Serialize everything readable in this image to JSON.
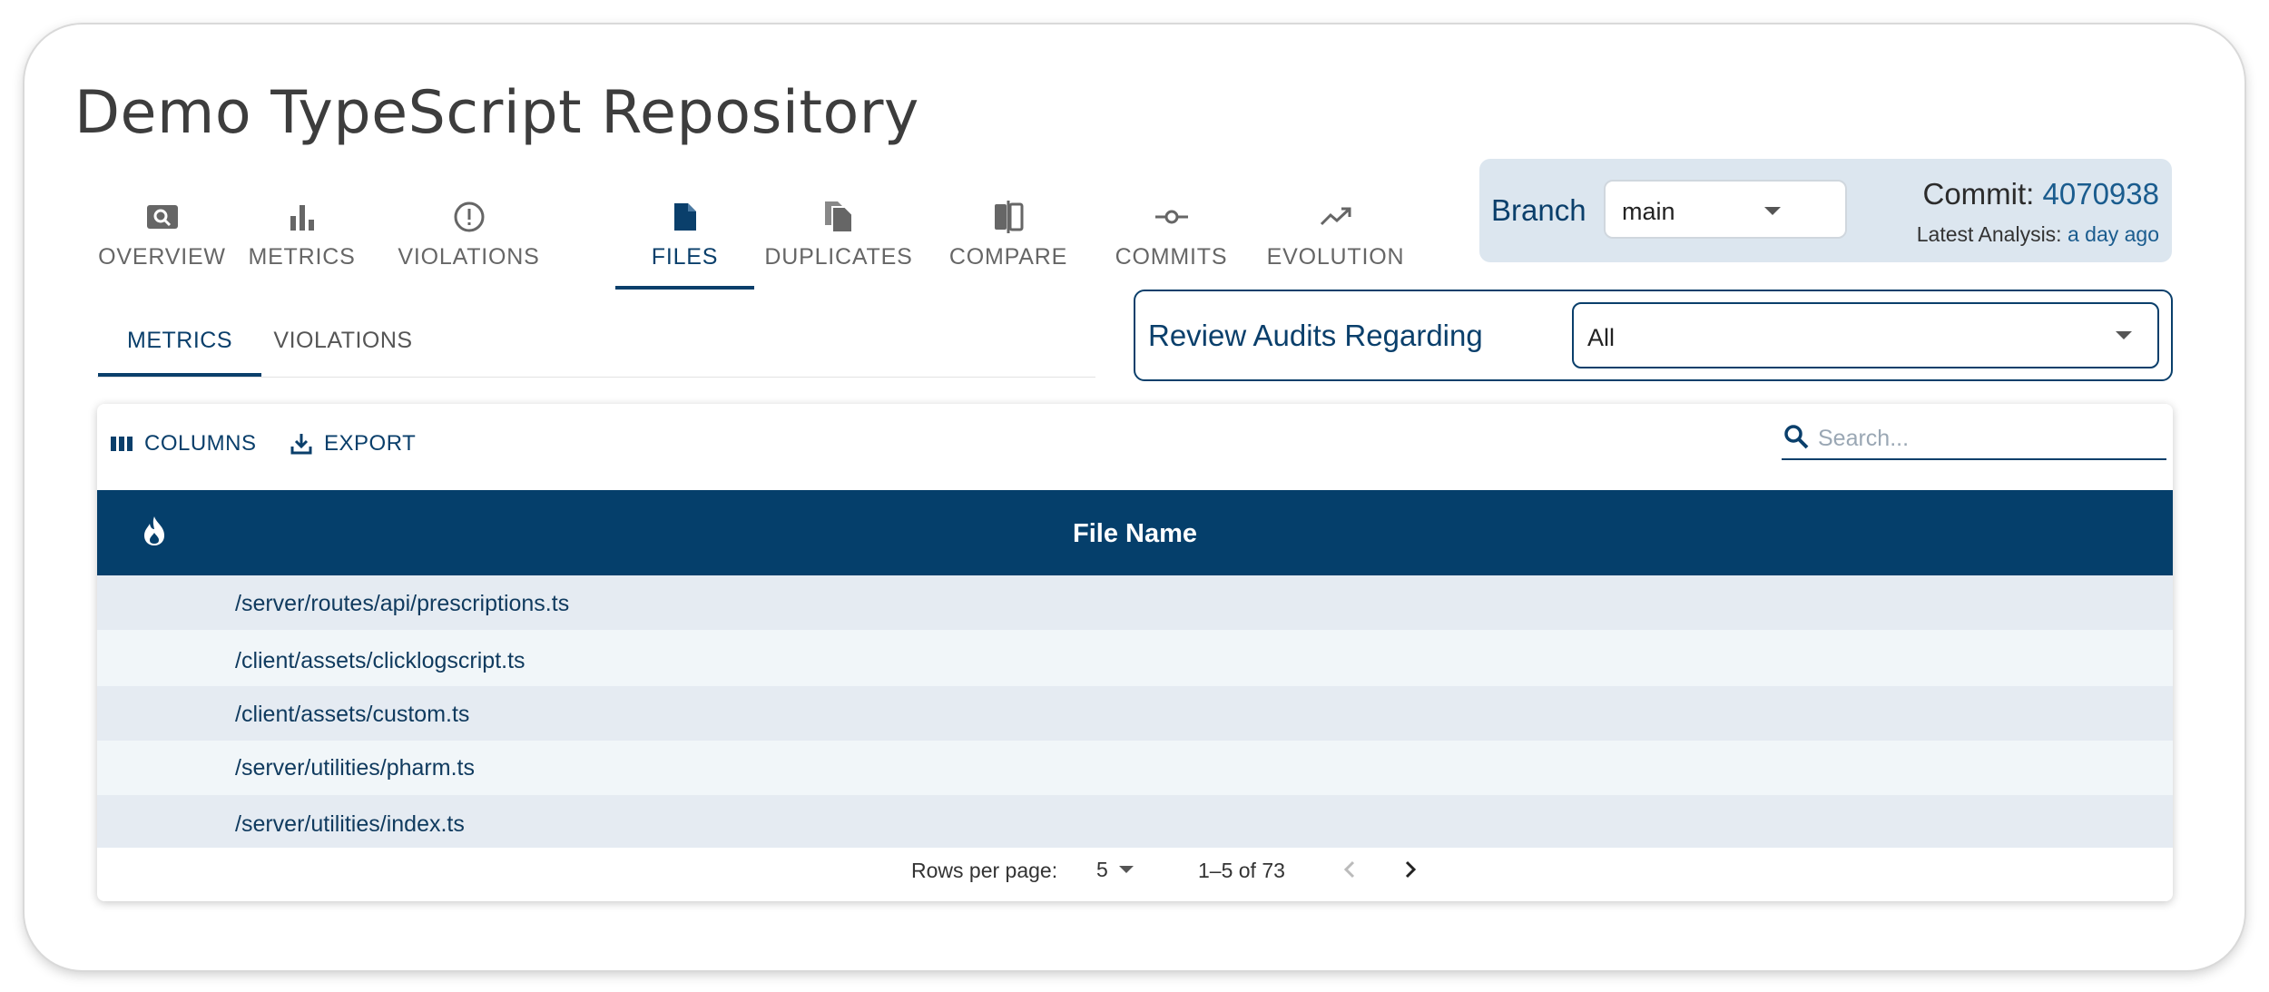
{
  "page": {
    "title": "Demo TypeScript Repository"
  },
  "main_tabs": [
    {
      "label": "OVERVIEW",
      "icon": "overview-icon"
    },
    {
      "label": "METRICS",
      "icon": "bar-chart-icon"
    },
    {
      "label": "VIOLATIONS",
      "icon": "alert-circle-icon"
    },
    {
      "label": "FILES",
      "icon": "file-icon",
      "active": true
    },
    {
      "label": "DUPLICATES",
      "icon": "duplicate-files-icon"
    },
    {
      "label": "COMPARE",
      "icon": "compare-icon"
    },
    {
      "label": "COMMITS",
      "icon": "commit-icon"
    },
    {
      "label": "EVOLUTION",
      "icon": "trending-up-icon"
    }
  ],
  "branch": {
    "label": "Branch",
    "selected": "main",
    "commit_label": "Commit:",
    "commit_hash": "4070938",
    "analysis_label": "Latest Analysis:",
    "analysis_value": "a day ago"
  },
  "sub_tabs": [
    {
      "label": "METRICS",
      "active": true
    },
    {
      "label": "VIOLATIONS"
    }
  ],
  "review": {
    "label": "Review Audits Regarding",
    "selected": "All"
  },
  "toolbar": {
    "columns_label": "COLUMNS",
    "export_label": "EXPORT",
    "search_placeholder": "Search..."
  },
  "table": {
    "header": {
      "hotspot_icon": "flame-icon",
      "file_name": "File Name"
    },
    "rows": [
      "/server/routes/api/prescriptions.ts",
      "/client/assets/clicklogscript.ts",
      "/client/assets/custom.ts",
      "/server/utilities/pharm.ts",
      "/server/utilities/index.ts"
    ]
  },
  "pagination": {
    "rows_per_page_label": "Rows per page:",
    "rows_per_page": "5",
    "range": "1–5 of 73"
  },
  "colors": {
    "primary": "#0a3f6b",
    "header_bg": "#053f6b",
    "branch_panel_bg": "#dce6ef",
    "row_odd": "#e5ebf2",
    "row_even": "#f1f6f9",
    "link": "#1a5c8e"
  }
}
